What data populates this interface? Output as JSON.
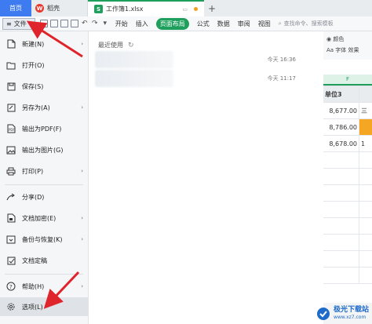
{
  "tabbar": {
    "home": "首页",
    "wps": "稻壳",
    "sheet": "工作簿1.xlsx",
    "add": "+"
  },
  "ribbon": {
    "file": "文件",
    "tabs": [
      "开始",
      "插入",
      "页面布局",
      "公式",
      "数据",
      "审阅",
      "视图"
    ],
    "active_index": 2,
    "search_placeholder": "查找命令、搜索模板"
  },
  "tools": {
    "color": "颜色",
    "font": "Aa 字体",
    "effect": "效果"
  },
  "sheet": {
    "column": "F",
    "header": "单位3",
    "values": [
      "8,677.00",
      "8,786.00",
      "8,678.00"
    ],
    "side": [
      "三",
      "",
      "1"
    ]
  },
  "menu": {
    "items": [
      {
        "label": "新建(N)",
        "icon": "new-icon",
        "arrow": true
      },
      {
        "label": "打开(O)",
        "icon": "open-icon",
        "arrow": false
      },
      {
        "label": "保存(S)",
        "icon": "save-icon",
        "arrow": false
      },
      {
        "label": "另存为(A)",
        "icon": "save-as-icon",
        "arrow": true
      },
      {
        "label": "输出为PDF(F)",
        "icon": "pdf-icon",
        "arrow": false
      },
      {
        "label": "输出为图片(G)",
        "icon": "image-icon",
        "arrow": false
      },
      {
        "label": "打印(P)",
        "icon": "print-icon",
        "arrow": true
      },
      {
        "label": "分享(D)",
        "icon": "share-icon",
        "arrow": false
      },
      {
        "label": "文档加密(E)",
        "icon": "lock-icon",
        "arrow": true
      },
      {
        "label": "备份与恢复(K)",
        "icon": "backup-icon",
        "arrow": true
      },
      {
        "label": "文档定稿",
        "icon": "finalize-icon",
        "arrow": false
      },
      {
        "label": "帮助(H)",
        "icon": "help-icon",
        "arrow": true
      },
      {
        "label": "选项(L)",
        "icon": "gear-icon",
        "arrow": false
      }
    ]
  },
  "recent": {
    "title": "最近使用",
    "items": [
      {
        "time": "今天 16:36"
      },
      {
        "time": "今天 11:17"
      }
    ]
  },
  "watermark": {
    "cn": "极光下载站",
    "url": "www.xz7.com"
  },
  "colors": {
    "accent": "#1e9f5c",
    "home_tab": "#3e7bf0",
    "arrow": "#e0242b"
  }
}
